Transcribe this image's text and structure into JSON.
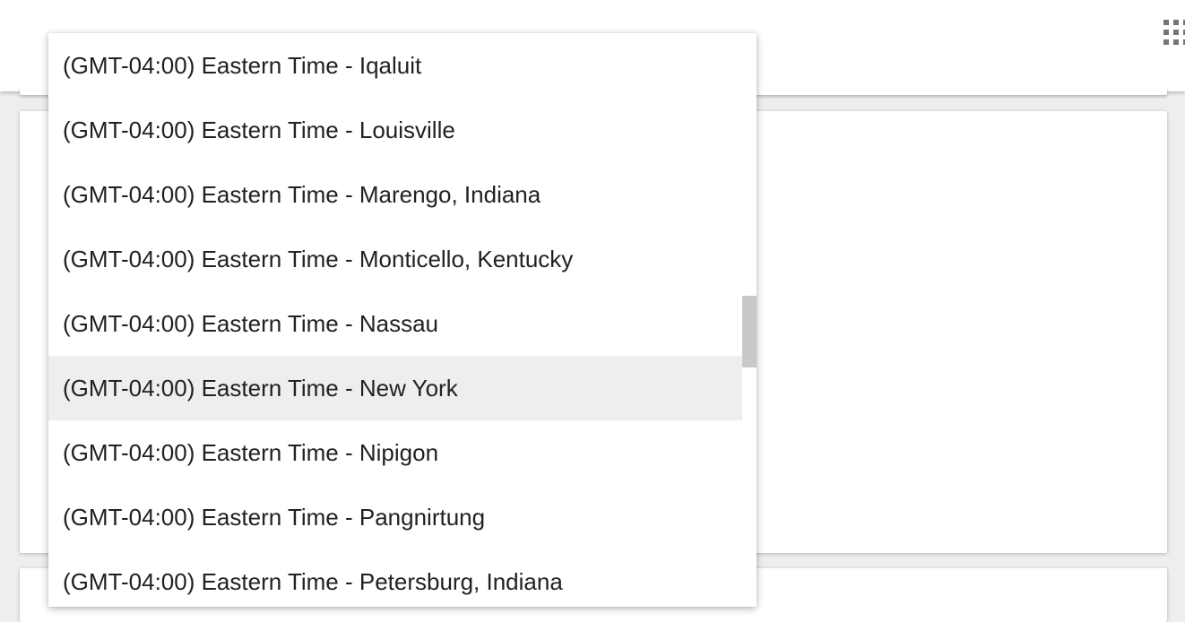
{
  "header": {
    "apps_icon": "apps-grid-icon"
  },
  "timezone_dropdown": {
    "selected": "(GMT-04:00) Eastern Time - New York",
    "options": [
      "(GMT-04:00) Eastern Time - Iqaluit",
      "(GMT-04:00) Eastern Time - Louisville",
      "(GMT-04:00) Eastern Time - Marengo, Indiana",
      "(GMT-04:00) Eastern Time - Monticello, Kentucky",
      "(GMT-04:00) Eastern Time - Nassau",
      "(GMT-04:00) Eastern Time - New York",
      "(GMT-04:00) Eastern Time - Nipigon",
      "(GMT-04:00) Eastern Time - Pangnirtung",
      "(GMT-04:00) Eastern Time - Petersburg, Indiana"
    ]
  },
  "colors": {
    "page_background": "#eeeeee",
    "surface": "#ffffff",
    "selected_option": "#eeeeee",
    "text": "#212121",
    "icon": "#757575",
    "scrollbar_thumb": "#c8c8c8"
  }
}
